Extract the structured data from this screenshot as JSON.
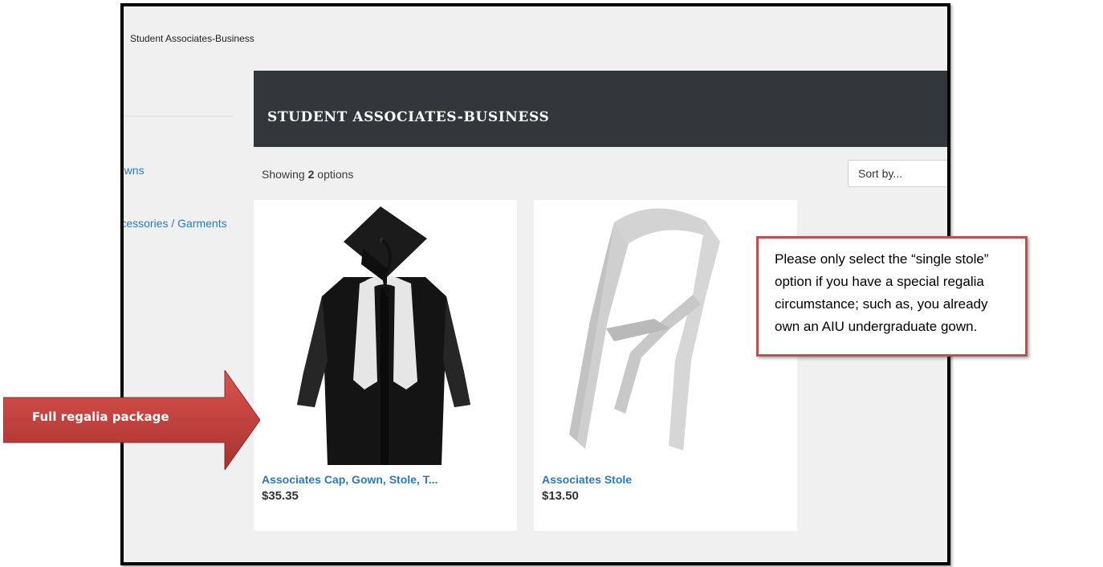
{
  "breadcrumb": "Student Associates-Business",
  "sidebar": {
    "items": [
      {
        "label": "Gowns"
      },
      {
        "label": "Accessories / Garments"
      }
    ]
  },
  "banner": {
    "title": "STUDENT ASSOCIATES-BUSINESS"
  },
  "results": {
    "prefix": "Showing",
    "count": "2",
    "suffix": "options"
  },
  "sort": {
    "label": "Sort by..."
  },
  "products": [
    {
      "name": "Associates Cap, Gown, Stole, T...",
      "price": "$35.35",
      "image": "cap-gown-stole"
    },
    {
      "name": "Associates Stole",
      "price": "$13.50",
      "image": "stole"
    }
  ],
  "annotations": {
    "callout": "Please only select the “single stole” option if you have a special regalia circumstance; such as, you already own an AIU undergraduate gown.",
    "arrow_label": "Full regalia package"
  },
  "colors": {
    "banner": "#33363a",
    "link": "#2d79b5",
    "callout_border": "#c0504d",
    "arrow_fill": "#c0504d",
    "frame_border": "#000000"
  }
}
